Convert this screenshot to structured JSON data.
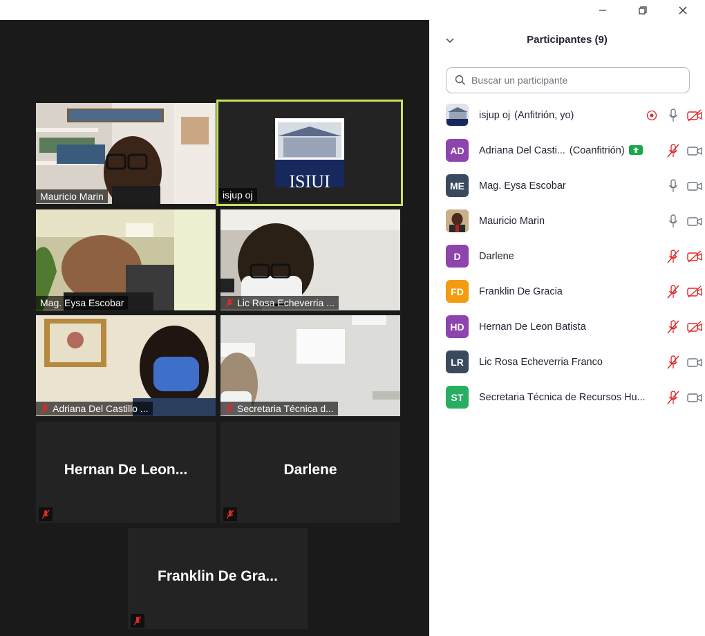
{
  "window": {
    "minimize_icon": "minimize-icon",
    "restore_icon": "restore-icon",
    "close_icon": "close-icon"
  },
  "gallery": {
    "tiles": [
      {
        "name": "Mauricio Marin",
        "muted": false,
        "type": "video"
      },
      {
        "name": "isjup oj",
        "muted": false,
        "type": "logo",
        "active": true
      },
      {
        "name": "Mag. Eysa Escobar",
        "muted": false,
        "type": "video"
      },
      {
        "name": "Lic Rosa Echeverria ...",
        "muted": true,
        "type": "video"
      },
      {
        "name": "Adriana Del Castillo ...",
        "muted": true,
        "type": "video"
      },
      {
        "name": "Secretaria Técnica d...",
        "muted": true,
        "type": "video"
      },
      {
        "name": "Hernan De Leon...",
        "muted": true,
        "type": "name"
      },
      {
        "name": "Darlene",
        "muted": true,
        "type": "name"
      },
      {
        "name": "Franklin De Gra...",
        "muted": true,
        "type": "name"
      }
    ]
  },
  "panel": {
    "title": "Participantes (9)",
    "search_placeholder": "Buscar un participante",
    "participants": [
      {
        "initials": "",
        "name": "isjup oj",
        "role": "(Anfitrión, yo)",
        "avatar": "logo",
        "color": "#ffffff",
        "recording": true,
        "mic": "on",
        "video": "off"
      },
      {
        "initials": "AD",
        "name": "Adriana Del Casti...",
        "role": "(Coanfitrión)",
        "avatar": "initials",
        "color": "#8e44ad",
        "sharing": true,
        "mic": "muted",
        "video": "on"
      },
      {
        "initials": "ME",
        "name": "Mag. Eysa Escobar",
        "role": "",
        "avatar": "initials",
        "color": "#3a4a5e",
        "mic": "on",
        "video": "on"
      },
      {
        "initials": "",
        "name": "Mauricio Marin",
        "role": "",
        "avatar": "photo",
        "color": "#6b3b2a",
        "mic": "on",
        "video": "on"
      },
      {
        "initials": "D",
        "name": "Darlene",
        "role": "",
        "avatar": "initials",
        "color": "#8e44ad",
        "mic": "muted",
        "video": "off"
      },
      {
        "initials": "FD",
        "name": "Franklin De Gracia",
        "role": "",
        "avatar": "initials",
        "color": "#f39c12",
        "mic": "muted",
        "video": "off"
      },
      {
        "initials": "HD",
        "name": "Hernan De Leon Batista",
        "role": "",
        "avatar": "initials",
        "color": "#8e44ad",
        "mic": "muted",
        "video": "off"
      },
      {
        "initials": "LR",
        "name": "Lic Rosa Echeverria Franco",
        "role": "",
        "avatar": "initials",
        "color": "#3a4a5e",
        "mic": "muted",
        "video": "on"
      },
      {
        "initials": "ST",
        "name": "Secretaria Técnica de Recursos Hu...",
        "role": "",
        "avatar": "initials",
        "color": "#27ae60",
        "mic": "muted",
        "video": "on"
      }
    ]
  },
  "colors": {
    "muted_red": "#e02828",
    "icon_gray": "#6e7680",
    "active_speaker": "#c8e25a",
    "share_green": "#1aa84b"
  }
}
